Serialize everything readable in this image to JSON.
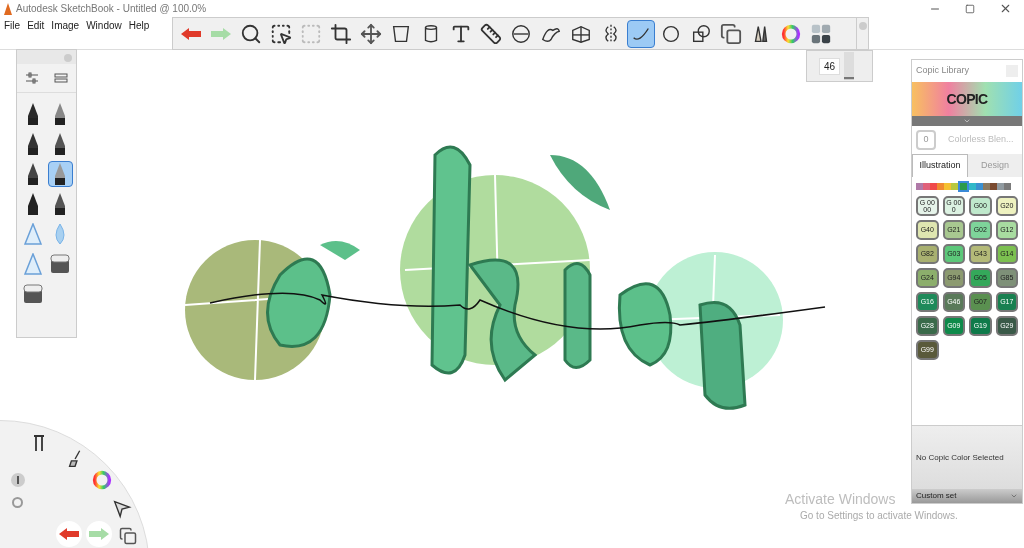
{
  "window": {
    "title": "Autodesk SketchBook - Untitled @ 100.0%"
  },
  "menu": [
    "File",
    "Edit",
    "Image",
    "Window",
    "Help"
  ],
  "toolbar": {
    "tools": [
      {
        "selected": false
      },
      {
        "selected": false
      },
      {
        "selected": false
      },
      {
        "selected": false
      },
      {
        "selected": false
      },
      {
        "selected": false
      },
      {
        "selected": false
      },
      {
        "selected": false
      },
      {
        "selected": false
      },
      {
        "selected": false
      },
      {
        "selected": false
      },
      {
        "selected": false
      },
      {
        "selected": false
      },
      {
        "selected": false
      },
      {
        "selected": false
      },
      {
        "selected": true
      },
      {
        "selected": false
      },
      {
        "selected": false
      },
      {
        "selected": false
      },
      {
        "selected": false
      },
      {
        "selected": false
      },
      {
        "selected": false
      }
    ]
  },
  "brush_size": {
    "value": "46",
    "level": 0.1
  },
  "brushes": [
    {
      "selected": false
    },
    {
      "selected": false
    },
    {
      "selected": false
    },
    {
      "selected": false
    },
    {
      "selected": false
    },
    {
      "selected": true
    },
    {
      "selected": false
    },
    {
      "selected": false
    },
    {
      "selected": false
    },
    {
      "selected": false
    },
    {
      "selected": false
    },
    {
      "selected": false
    },
    {
      "selected": false
    }
  ],
  "copic": {
    "title": "Copic Library",
    "logo": "COPIC",
    "blender": {
      "code": "0",
      "label": "Colorless Blen..."
    },
    "tabs": [
      {
        "label": "Illustration",
        "selected": true
      },
      {
        "label": "Design",
        "selected": false
      }
    ],
    "families": [
      {
        "color": "#b07aa8",
        "selected": false
      },
      {
        "color": "#e0607a",
        "selected": false
      },
      {
        "color": "#f04a4a",
        "selected": false
      },
      {
        "color": "#f08a30",
        "selected": false
      },
      {
        "color": "#f5c030",
        "selected": false
      },
      {
        "color": "#b8c840",
        "selected": false
      },
      {
        "color": "#2a9a4a",
        "selected": true
      },
      {
        "color": "#30b8c8",
        "selected": false
      },
      {
        "color": "#3a90d0",
        "selected": false
      },
      {
        "color": "#8a7a60",
        "selected": false
      },
      {
        "color": "#7a4a30",
        "selected": false
      },
      {
        "color": "#909aa0",
        "selected": false
      },
      {
        "color": "#7a7a7a",
        "selected": false
      }
    ],
    "markers": [
      {
        "label": "G 0000",
        "color": "#e6f4ea"
      },
      {
        "label": "G 000",
        "color": "#dcf2e2"
      },
      {
        "label": "G00",
        "color": "#bfe9cc"
      },
      {
        "label": "G20",
        "color": "#eef2c0"
      },
      {
        "label": "G40",
        "color": "#dfe6b0"
      },
      {
        "label": "G21",
        "color": "#a8c890"
      },
      {
        "label": "G02",
        "color": "#7ed49a"
      },
      {
        "label": "G12",
        "color": "#a8dca0"
      },
      {
        "label": "G82",
        "color": "#a8b070"
      },
      {
        "label": "G03",
        "color": "#5cc87a"
      },
      {
        "label": "G43",
        "color": "#b4ba78"
      },
      {
        "label": "G14",
        "color": "#7cc050"
      },
      {
        "label": "G24",
        "color": "#8cae6c"
      },
      {
        "label": "G94",
        "color": "#8c9a70"
      },
      {
        "label": "G05",
        "color": "#34a85a"
      },
      {
        "label": "G85",
        "color": "#7e9078"
      },
      {
        "label": "G16",
        "color": "#1e8a5a"
      },
      {
        "label": "G46",
        "color": "#5a7a5a"
      },
      {
        "label": "G07",
        "color": "#5a9050"
      },
      {
        "label": "G17",
        "color": "#188050"
      },
      {
        "label": "G28",
        "color": "#3a6a4a"
      },
      {
        "label": "G09",
        "color": "#0e8a4a"
      },
      {
        "label": "G19",
        "color": "#0e7a4a"
      },
      {
        "label": "G29",
        "color": "#3a5a48"
      },
      {
        "label": "G99",
        "color": "#5a5a3a"
      }
    ],
    "status": "No Copic Color Selected",
    "set": "Custom set"
  },
  "activation": {
    "title": "Activate Windows",
    "subtitle": "Go to Settings to activate Windows."
  }
}
